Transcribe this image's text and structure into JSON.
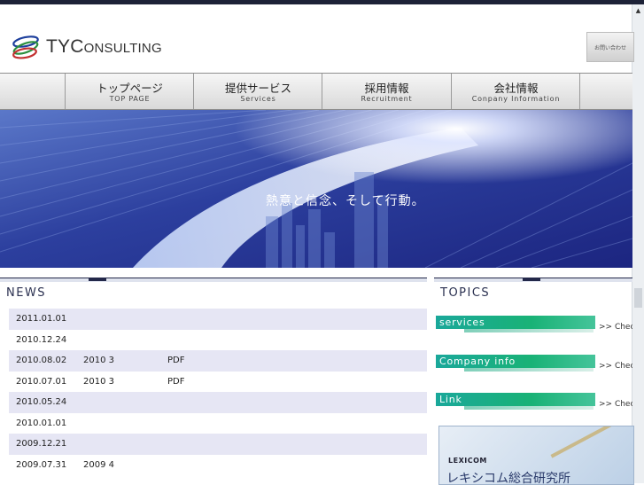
{
  "header": {
    "logo_text": "TYC",
    "logo_text_rest": "ONSULTING",
    "contact_label": "お問い合わせ"
  },
  "nav": {
    "items": [
      {
        "jp": "トップページ",
        "en": "TOP PAGE"
      },
      {
        "jp": "提供サービス",
        "en": "Services"
      },
      {
        "jp": "採用情報",
        "en": "Recruitment"
      },
      {
        "jp": "会社情報",
        "en": "Conpany Information"
      }
    ]
  },
  "hero": {
    "tagline": "熱意と信念、そして行動。"
  },
  "news": {
    "title": "NEWS",
    "rows": [
      {
        "date": "2011.01.01",
        "text": "",
        "pdf": ""
      },
      {
        "date": "2010.12.24",
        "text": "",
        "pdf": ""
      },
      {
        "date": "2010.08.02",
        "text": "2010 3",
        "pdf": "PDF"
      },
      {
        "date": "2010.07.01",
        "text": "2010 3",
        "pdf": "PDF"
      },
      {
        "date": "2010.05.24",
        "text": "",
        "pdf": ""
      },
      {
        "date": "2010.01.01",
        "text": "",
        "pdf": ""
      },
      {
        "date": "2009.12.21",
        "text": "",
        "pdf": ""
      },
      {
        "date": "2009.07.31",
        "text": "2009 4",
        "pdf": ""
      }
    ]
  },
  "topics": {
    "title": "TOPICS",
    "items": [
      {
        "label": "services",
        "check": ">> Check"
      },
      {
        "label": "Company info",
        "check": ">> Check"
      },
      {
        "label": "Link",
        "check": ">> Check"
      }
    ],
    "banner": {
      "brand": "LEXICOM",
      "jp": "レキシコム総合研究所"
    }
  }
}
